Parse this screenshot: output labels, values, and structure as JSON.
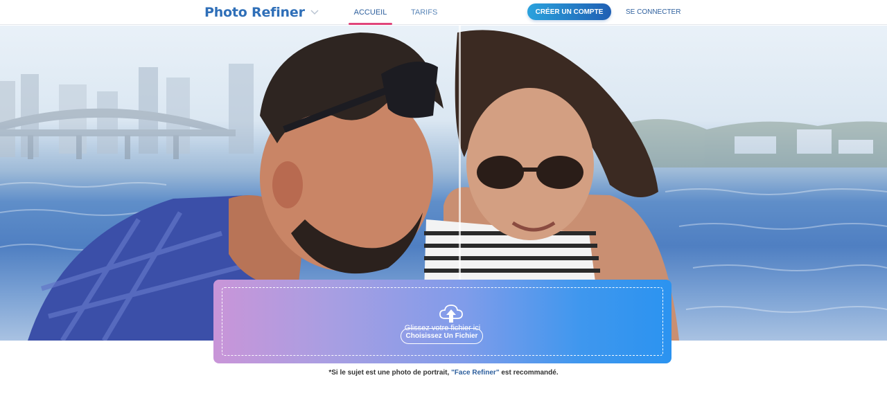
{
  "header": {
    "logo": "Photo Refiner",
    "nav": [
      {
        "label": "ACCUEIL",
        "active": true
      },
      {
        "label": "TARIFS",
        "active": false
      }
    ],
    "signup_label": "CRÉER UN COMPTE",
    "login_label": "SE CONNECTER"
  },
  "upload": {
    "drop_text": "Glissez votre fichier ici",
    "choose_label": "Choisissez Un Fichier"
  },
  "note": {
    "prefix": "*Si le sujet est une photo de portrait, ",
    "link": "\"Face Refiner\"",
    "suffix": " est recommandé."
  },
  "colors": {
    "brand_blue": "#2f6fb8",
    "active_underline": "#e0447a",
    "gradient_start": "#c995d8",
    "gradient_end": "#2b93f0"
  },
  "icons": [
    "chevron-down-icon",
    "cloud-upload-icon"
  ]
}
